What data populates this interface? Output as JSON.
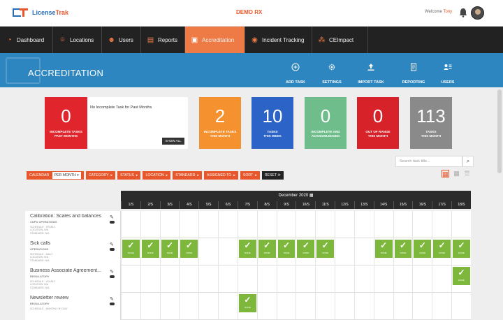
{
  "header": {
    "logo_prefix": "License",
    "logo_suffix": "Trak",
    "center_title": "DEMO RX",
    "welcome_label": "Welcome",
    "user_name": "Tony"
  },
  "nav": {
    "items": [
      {
        "label": "Dashboard",
        "icon": "gauge-icon"
      },
      {
        "label": "Locations",
        "icon": "map-pin-icon"
      },
      {
        "label": "Users",
        "icon": "users-icon"
      },
      {
        "label": "Reports",
        "icon": "report-icon"
      },
      {
        "label": "Accreditation",
        "icon": "certificate-icon",
        "active": true
      },
      {
        "label": "Incident Tracking",
        "icon": "incident-icon"
      },
      {
        "label": "CEImpact",
        "icon": "network-icon"
      }
    ]
  },
  "banner": {
    "title": "ACCREDITATION",
    "actions": [
      {
        "label": "ADD TASK",
        "icon": "plus-circle-icon"
      },
      {
        "label": "SETTINGS",
        "icon": "gear-icon"
      },
      {
        "label": "IMPORT TASK",
        "icon": "upload-icon"
      },
      {
        "label": "REPORTING",
        "icon": "document-icon"
      },
      {
        "label": "USERS",
        "icon": "users-list-icon"
      }
    ]
  },
  "cards": {
    "incomplete_past": {
      "value": "0",
      "label": "INCOMPLETE TASKS\nPAST MONTHS",
      "color": "#e0262c"
    },
    "message": "No Incomplete Task for Past Months",
    "show_all": "SHOW ALL",
    "incomplete_month": {
      "value": "2",
      "label": "INCOMPLETE TASKS\nTHIS MONTH",
      "color": "#f5922f"
    },
    "tasks_week": {
      "value": "10",
      "label": "TASKS\nTHIS WEEK",
      "color": "#2b64c6"
    },
    "incomplete_ack": {
      "value": "0",
      "label": "INCOMPLETE AND\nACKNOWLEDGED",
      "color": "#6ebd8a"
    },
    "out_of_range": {
      "value": "0",
      "label": "OUT OF RANGE\nTHIS MONTH",
      "color": "#d8222a"
    },
    "tasks_month": {
      "value": "113",
      "label": "TASKS\nTHIS MONTH",
      "color": "#8a8a8a"
    }
  },
  "search": {
    "placeholder": "Search task title..."
  },
  "filters": {
    "calendar_label": "CALENDAR",
    "calendar_value": "PER MONTH",
    "chips": [
      "CATEGORY",
      "STATUS",
      "LOCATION",
      "STANDARD",
      "ASSIGNED TO",
      "SORT"
    ],
    "reset": "RESET"
  },
  "calendar": {
    "month": "December 2020",
    "days": [
      "1/S",
      "2/S",
      "3/S",
      "4/S",
      "5/S",
      "6/S",
      "7/S",
      "8/S",
      "9/S",
      "10/S",
      "11/S",
      "12/S",
      "13/S",
      "14/S",
      "15/S",
      "16/S",
      "17/S",
      "18/S"
    ],
    "done_tag": "DONE"
  },
  "tasks": [
    {
      "title": "Calibration: Scales and balances",
      "category": "CNPD OPERATIONS",
      "meta": "SCHEDULE : YEARLY\nLOCATION: N/A\nSTANDARD: N/A",
      "done": []
    },
    {
      "title": "Sick calls",
      "category": "OPERATIONS",
      "meta": "SCHEDULE : DAILY\nLOCATION: N/A\nSTANDARD: N/A",
      "done": [
        0,
        1,
        2,
        3,
        6,
        7,
        8,
        9,
        10,
        13,
        14,
        15,
        16,
        17
      ]
    },
    {
      "title": "Business Associate Agreement...",
      "category": "REGULATORY",
      "meta": "SCHEDULE : YEARLY\nLOCATION: N/A\nSTANDARD: N/A",
      "done": [
        17
      ]
    },
    {
      "title": "Newsletter review",
      "category": "REGULATORY",
      "meta": "SCHEDULE : MONTHLY BY DAY",
      "done": [
        6
      ]
    }
  ]
}
